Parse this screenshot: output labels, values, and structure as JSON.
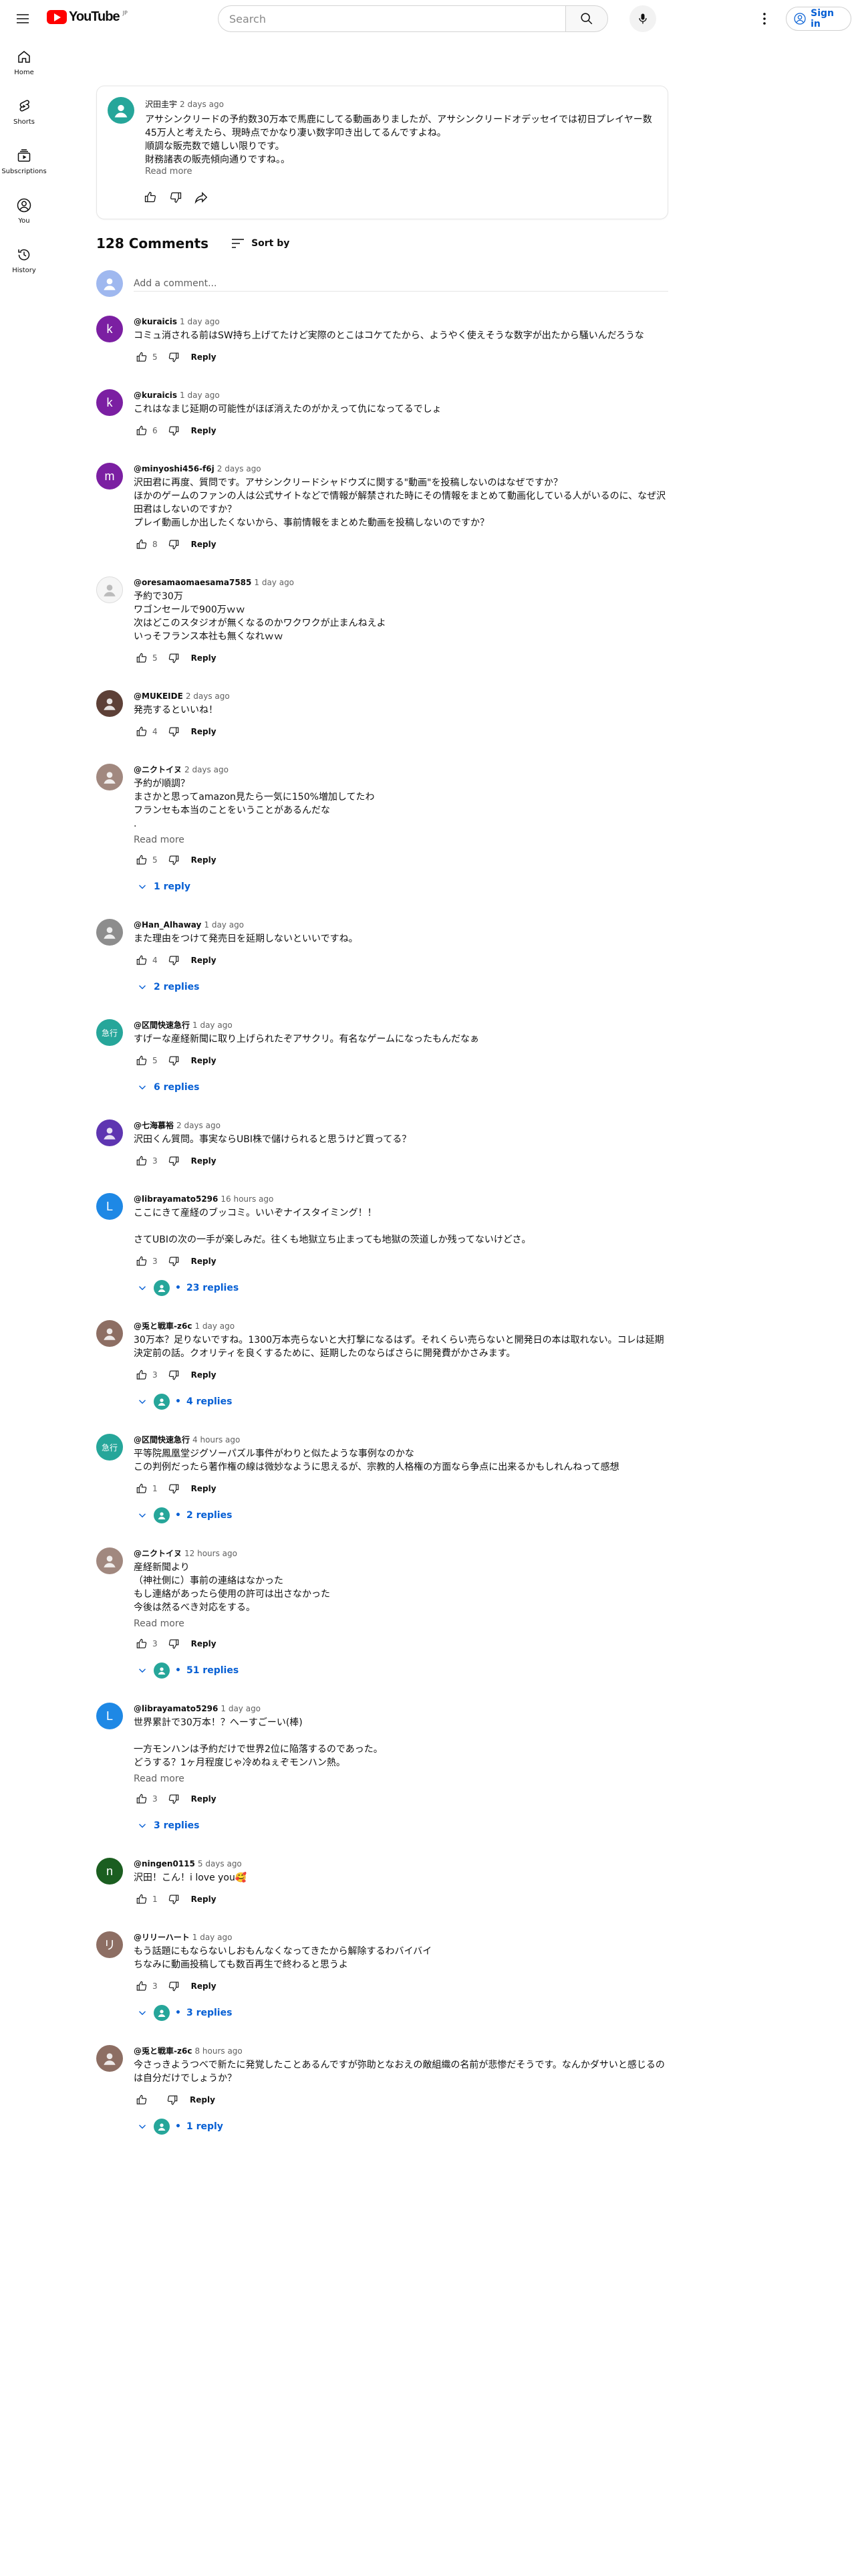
{
  "masthead": {
    "logo_text": "YouTube",
    "logo_country": "JP",
    "search_placeholder": "Search",
    "signin_label": "Sign in"
  },
  "sidebar": {
    "items": [
      {
        "label": "Home",
        "icon": "home-icon"
      },
      {
        "label": "Shorts",
        "icon": "shorts-icon"
      },
      {
        "label": "Subscriptions",
        "icon": "subscriptions-icon"
      },
      {
        "label": "You",
        "icon": "you-icon"
      },
      {
        "label": "History",
        "icon": "history-icon"
      }
    ]
  },
  "video_description": {
    "author": "沢田圭宇",
    "time": "2 days ago",
    "text": "アサシンクリードの予約数30万本で馬鹿にしてる動画ありましたが、アサシンクリードオデッセイでは初日プレイヤー数45万人と考えたら、現時点でかなり凄い数字叩き出してるんですよね。\n順調な販売数で嬉しい限りです。\n財務諸表の販売傾向通りですね。。",
    "read_more": "Read more"
  },
  "comments_header": {
    "count": "128 Comments",
    "sort_label": "Sort by"
  },
  "add_comment": {
    "placeholder": "Add a comment..."
  },
  "labels": {
    "reply": "Reply",
    "read_more": "Read more"
  },
  "colors": {
    "link_blue": "#065fd4",
    "brand_red": "#ff0000",
    "secondary_text": "#606060"
  },
  "comments": [
    {
      "author": "@kuraicis",
      "time": "1 day ago",
      "avatar_letter": "k",
      "avatar_color": "#7b1fa2",
      "text": "コミュ消される前はSW持ち上げてたけど実際のとこはコケてたから、ようやく使えそうな数字が出たから騒いんだろうな",
      "likes": "5",
      "read_more": false,
      "replies": ""
    },
    {
      "author": "@kuraicis",
      "time": "1 day ago",
      "avatar_letter": "k",
      "avatar_color": "#7b1fa2",
      "text": "これはなまじ延期の可能性がほぼ消えたのがかえって仇になってるでしょ",
      "likes": "6",
      "read_more": false,
      "replies": ""
    },
    {
      "author": "@minyoshi456-f6j",
      "time": "2 days ago",
      "avatar_letter": "m",
      "avatar_color": "#7b1fa2",
      "text": "沢田君に再度、質問です。アサシンクリードシャドウズに関する\"動画\"を投稿しないのはなぜですか？\nほかのゲームのファンの人は公式サイトなどで情報が解禁された時にその情報をまとめて動画化している人がいるのに、なぜ沢田君はしないのですか？\nプレイ動画しか出したくないから、事前情報をまとめた動画を投稿しないのですか？",
      "likes": "8",
      "read_more": false,
      "replies": ""
    },
    {
      "author": "@oresamaomaesama7585",
      "time": "1 day ago",
      "avatar_letter": "",
      "avatar_color": "#f5f5f5",
      "text": "予約で30万\nワゴンセールで900万ｗｗ\n次はどこのスタジオが無くなるのかワクワクが止まんねえよ\nいっそフランス本社も無くなれｗｗ",
      "likes": "5",
      "read_more": false,
      "replies": ""
    },
    {
      "author": "@MUKEIDE",
      "time": "2 days ago",
      "avatar_letter": "",
      "avatar_color": "#5d4037",
      "text": "発売するといいね！",
      "likes": "4",
      "read_more": false,
      "replies": ""
    },
    {
      "author": "@ニクトイヌ",
      "time": "2 days ago",
      "avatar_letter": "",
      "avatar_color": "#a1887f",
      "text": "予約が順調？\nまさかと思ってamazon見たら一気に150%増加してたわ\nフランセも本当のことをいうことがあるんだな\n.",
      "likes": "5",
      "read_more": true,
      "replies": "1 reply"
    },
    {
      "author": "@Han_Alhaway",
      "time": "1 day ago",
      "avatar_letter": "",
      "avatar_color": "#8d8d8d",
      "text": "また理由をつけて発売日を延期しないといいですね。",
      "likes": "4",
      "read_more": false,
      "replies": "2 replies"
    },
    {
      "author": "@区間快速急行",
      "time": "1 day ago",
      "avatar_letter": "急行",
      "avatar_color": "#26a69a",
      "text": "すげーな産経新聞に取り上げられたぞアサクリ。有名なゲームになったもんだなぁ",
      "likes": "5",
      "read_more": false,
      "replies": "6 replies"
    },
    {
      "author": "@七海慕裕",
      "time": "2 days ago",
      "avatar_letter": "",
      "avatar_color": "#5e35b1",
      "text": "沢田くん質問。事実ならUBI株で儲けられると思うけど買ってる？",
      "likes": "3",
      "read_more": false,
      "replies": ""
    },
    {
      "author": "@librayamato5296",
      "time": "16 hours ago",
      "avatar_letter": "L",
      "avatar_color": "#1e88e5",
      "text": "ここにきて産経のブッコミ。いいぞナイスタイミング！！\n\nさてUBIの次の一手が楽しみだ。往くも地獄立ち止まっても地獄の茨道しか残ってないけどさ。",
      "likes": "3",
      "read_more": false,
      "replies": "23 replies",
      "reply_avatar": true
    },
    {
      "author": "@兎と戦車-z6c",
      "time": "1 day ago",
      "avatar_letter": "",
      "avatar_color": "#8d6e63",
      "text": "30万本？足りないですね。1300万本売らないと大打撃になるはず。それくらい売らないと開発日の本は取れない。コレは延期決定前の話。クオリティを良くするために、延期したのならばさらに開発費がかさみます。",
      "likes": "3",
      "read_more": false,
      "replies": "4 replies",
      "reply_avatar": true
    },
    {
      "author": "@区間快速急行",
      "time": "4 hours ago",
      "avatar_letter": "急行",
      "avatar_color": "#26a69a",
      "text": "平等院鳳凰堂ジグソーパズル事件がわりと似たような事例なのかな\nこの判例だったら著作権の線は微妙なように思えるが、宗教的人格権の方面なら争点に出来るかもしれんねって感想",
      "likes": "1",
      "read_more": false,
      "replies": "2 replies",
      "reply_avatar": true
    },
    {
      "author": "@ニクトイヌ",
      "time": "12 hours ago",
      "avatar_letter": "",
      "avatar_color": "#a1887f",
      "text": "産経新聞より\n（神社側に）事前の連絡はなかった\nもし連絡があったら使用の許可は出さなかった\n今後は然るべき対応をする。",
      "likes": "3",
      "read_more": true,
      "replies": "51 replies",
      "reply_avatar": true
    },
    {
      "author": "@librayamato5296",
      "time": "1 day ago",
      "avatar_letter": "L",
      "avatar_color": "#1e88e5",
      "text": "世界累計で30万本！？へーすごーい(棒)\n\n一方モンハンは予約だけで世界2位に陥落するのであった。\nどうする？1ヶ月程度じゃ冷めねぇぞモンハン熱。",
      "likes": "3",
      "read_more": true,
      "replies": "3 replies"
    },
    {
      "author": "@ningen0115",
      "time": "5 days ago",
      "avatar_letter": "n",
      "avatar_color": "#1b5e20",
      "text": "沢田！こん！i love you🥰",
      "likes": "1",
      "read_more": false,
      "replies": ""
    },
    {
      "author": "@リリーハート",
      "time": "1 day ago",
      "avatar_letter": "リ",
      "avatar_color": "#8d6e63",
      "text": "もう話題にもならないしおもんなくなってきたから解除するわバイバイ\nちなみに動画投稿しても数百再生で終わると思うよ",
      "likes": "3",
      "read_more": false,
      "replies": "3 replies",
      "reply_avatar": true
    },
    {
      "author": "@兎と戦車-z6c",
      "time": "8 hours ago",
      "avatar_letter": "",
      "avatar_color": "#8d6e63",
      "text": "今さっきようつべで新たに発覚したことあるんですが弥助となおえの敵組織の名前が悲惨だそうです。なんかダサいと感じるのは自分だけでしょうか？",
      "likes": "",
      "read_more": false,
      "replies": "1 reply",
      "reply_avatar": true
    }
  ]
}
